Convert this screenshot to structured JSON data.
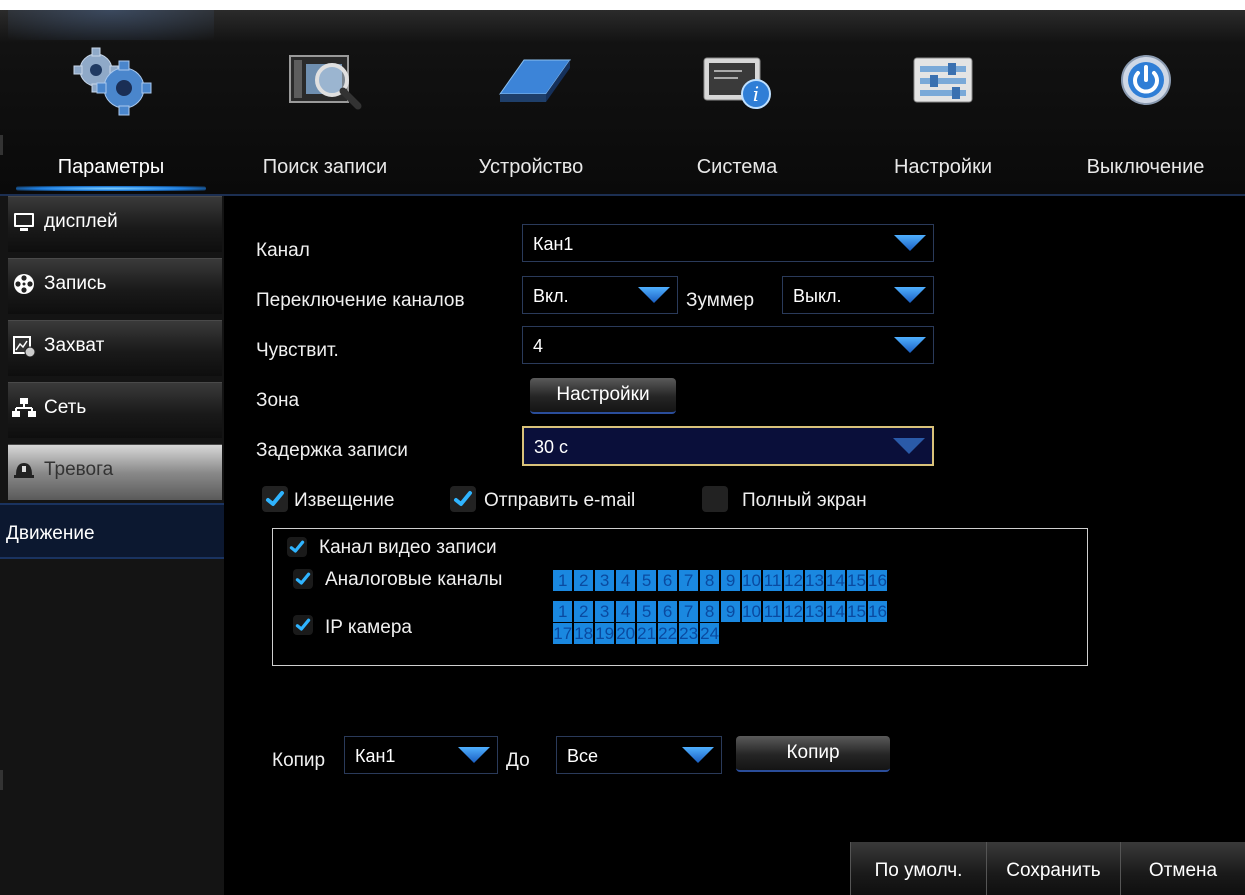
{
  "nav": {
    "tabs": [
      {
        "label": "Параметры",
        "icon": "gears-icon",
        "active": true
      },
      {
        "label": "Поиск записи",
        "icon": "film-search-icon"
      },
      {
        "label": "Устройство",
        "icon": "hard-drive-icon"
      },
      {
        "label": "Система",
        "icon": "system-info-icon"
      },
      {
        "label": "Настройки",
        "icon": "sliders-icon"
      },
      {
        "label": "Выключение",
        "icon": "power-icon"
      }
    ]
  },
  "sidebar": {
    "items": [
      {
        "label": "дисплей",
        "icon": "monitor-icon"
      },
      {
        "label": "Запись",
        "icon": "film-reel-icon"
      },
      {
        "label": "Захват",
        "icon": "snapshot-icon"
      },
      {
        "label": "Сеть",
        "icon": "network-icon"
      },
      {
        "label": "Тревога",
        "icon": "alarm-bell-icon",
        "active": true
      }
    ],
    "sub_item": "Движение"
  },
  "form": {
    "channel_label": "Канал",
    "channel_value": "Кан1",
    "switch_label": "Переключение каналов",
    "switch_value": "Вкл.",
    "buzzer_label": "Зуммер",
    "buzzer_value": "Выкл.",
    "sensitivity_label": "Чувствит.",
    "sensitivity_value": "4",
    "zone_label": "Зона",
    "zone_button": "Настройки",
    "delay_label": "Задержка записи",
    "delay_value": "30 с",
    "notify_label": "Извещение",
    "notify_checked": true,
    "email_label": "Отправить e-mail",
    "email_checked": true,
    "fullscreen_label": "Полный экран",
    "fullscreen_checked": false
  },
  "record_group": {
    "title": "Канал видео записи",
    "analog_label": "Аналоговые каналы",
    "ip_label": "IP камера",
    "analog_channels": [
      "1",
      "2",
      "3",
      "4",
      "5",
      "6",
      "7",
      "8",
      "9",
      "10",
      "11",
      "12",
      "13",
      "14",
      "15",
      "16"
    ],
    "ip_channels": [
      "1",
      "2",
      "3",
      "4",
      "5",
      "6",
      "7",
      "8",
      "9",
      "10",
      "11",
      "12",
      "13",
      "14",
      "15",
      "16",
      "17",
      "18",
      "19",
      "20",
      "21",
      "22",
      "23",
      "24"
    ]
  },
  "copy": {
    "label": "Копир",
    "from_value": "Кан1",
    "to_label": "До",
    "to_value": "Все",
    "button": "Копир"
  },
  "footer": {
    "default_label": "По умолч.",
    "save_label": "Сохранить",
    "cancel_label": "Отмена"
  },
  "colors": {
    "accent": "#1a88e0",
    "focus_border": "#d9c27a"
  }
}
